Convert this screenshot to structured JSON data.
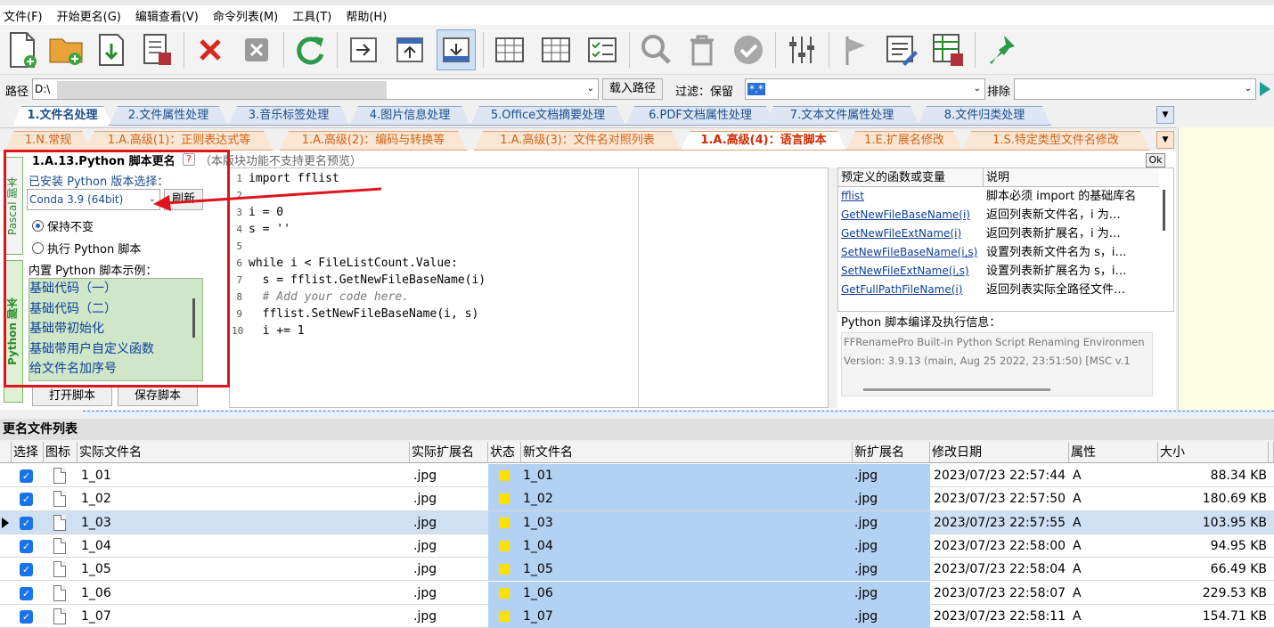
{
  "menu": [
    "文件(F)",
    "开始更名(G)",
    "编辑查看(V)",
    "命令列表(M)",
    "工具(T)",
    "帮助(H)"
  ],
  "icons": {
    "new": "new-file-icon",
    "open": "open-folder-icon",
    "import": "import-icon",
    "save": "save-icon",
    "delete": "delete-x-icon",
    "clear": "clear-x-icon",
    "refresh": "refresh-icon",
    "move": "move-icon",
    "up": "up-icon",
    "down": "down-icon",
    "grid1": "grid-view-icon",
    "grid2": "grid-view2-icon",
    "checklist": "checklist-icon",
    "search": "search-icon",
    "trash": "trash-icon",
    "check": "check-icon",
    "sliders": "sliders-icon",
    "flag": "flag-icon",
    "edit": "edit-doc-icon",
    "savegrid": "save-grid-icon",
    "pin": "pin-icon"
  },
  "pathbar": {
    "path_label": "路径",
    "path_value": "D:\\",
    "load_button": "载入路径",
    "filter_label": "过滤：保留",
    "filter_value": "*.*",
    "exclude_label": "排除"
  },
  "tabs_primary": [
    "1.文件名处理",
    "2.文件属性处理",
    "3.音乐标签处理",
    "4.图片信息处理",
    "5.Office文档摘要处理",
    "6.PDF文档属性处理",
    "7.文本文件属性处理",
    "8.文件归类处理"
  ],
  "tabs_secondary": [
    "1.N.常规",
    "1.A.高级(1)：正则表达式等",
    "1.A.高级(2)：编码与转换等",
    "1.A.高级(3)：文件名对照列表",
    "1.A.高级(4)：语言脚本",
    "1.E.扩展名修改",
    "1.S.特定类型文件名修改"
  ],
  "vertical_tabs": {
    "pascal": "Pascal 脚本",
    "python": "Python 脚本"
  },
  "script_panel": {
    "title": "1.A.13.Python 脚本更名",
    "help": "?",
    "note": "（本版块功能不支持更名预览）",
    "ok": "Ok",
    "installed_label": "已安装 Python 版本选择：",
    "version": "Conda 3.9 (64bit)",
    "refresh_button": "刷新",
    "keep_option": "保持不变",
    "run_option": "执行 Python 脚本",
    "examples_label": "内置 Python 脚本示例：",
    "examples": [
      "基础代码（一）",
      "基础代码（二）",
      "基础带初始化",
      "基础带用户自定义函数",
      "给文件名加序号"
    ],
    "open_button": "打开脚本",
    "save_button": "保存脚本"
  },
  "editor": {
    "lines": [
      {
        "n": "1",
        "code": "import fflist"
      },
      {
        "n": "2",
        "code": ""
      },
      {
        "n": "3",
        "code": "i = 0"
      },
      {
        "n": "4",
        "code": "s = ''"
      },
      {
        "n": "5",
        "code": ""
      },
      {
        "n": "6",
        "code": "while i < FileListCount.Value:"
      },
      {
        "n": "7",
        "code": "  s = fflist.GetNewFileBaseName(i)"
      },
      {
        "n": "8",
        "code": "  # Add your code here."
      },
      {
        "n": "9",
        "code": "  fflist.SetNewFileBaseName(i, s)"
      },
      {
        "n": "10",
        "code": "  i += 1"
      }
    ]
  },
  "functions": {
    "header_name": "预定义的函数或变量",
    "header_desc": "说明",
    "rows": [
      {
        "name": "fflist",
        "desc": "脚本必须 import 的基础库名"
      },
      {
        "name": "GetNewFileBaseName(i)",
        "desc": "返回列表新文件名，i 为…"
      },
      {
        "name": "GetNewFileExtName(i)",
        "desc": "返回列表新扩展名，i 为…"
      },
      {
        "name": "SetNewFileBaseName(i,s)",
        "desc": "设置列表新文件名为 s，i…"
      },
      {
        "name": "SetNewFileExtName(i,s)",
        "desc": "设置列表新扩展名为 s，i…"
      },
      {
        "name": "GetFullPathFileName(i)",
        "desc": "返回列表实际全路径文件…"
      }
    ]
  },
  "info": {
    "title": "Python 脚本编译及执行信息：",
    "line1": "FFRenamePro Built-in Python Script Renaming Environmen",
    "line2": "Version:  3.9.13 (main, Aug 25 2022, 23:51:50) [MSC v.1"
  },
  "list_title": "更名文件列表",
  "columns": [
    "选择",
    "图标",
    "实际文件名",
    "实际扩展名",
    "状态",
    "新文件名",
    "新扩展名",
    "修改日期",
    "属性",
    "大小"
  ],
  "files": [
    {
      "name": "1_01",
      "ext": ".jpg",
      "new": "1_01",
      "newext": ".jpg",
      "date": "2023/07/23 22:57:44",
      "attr": "A",
      "size": "88.34 KB"
    },
    {
      "name": "1_02",
      "ext": ".jpg",
      "new": "1_02",
      "newext": ".jpg",
      "date": "2023/07/23 22:57:50",
      "attr": "A",
      "size": "180.69 KB"
    },
    {
      "name": "1_03",
      "ext": ".jpg",
      "new": "1_03",
      "newext": ".jpg",
      "date": "2023/07/23 22:57:55",
      "attr": "A",
      "size": "103.95 KB"
    },
    {
      "name": "1_04",
      "ext": ".jpg",
      "new": "1_04",
      "newext": ".jpg",
      "date": "2023/07/23 22:58:00",
      "attr": "A",
      "size": "94.95 KB"
    },
    {
      "name": "1_05",
      "ext": ".jpg",
      "new": "1_05",
      "newext": ".jpg",
      "date": "2023/07/23 22:58:04",
      "attr": "A",
      "size": "66.49 KB"
    },
    {
      "name": "1_06",
      "ext": ".jpg",
      "new": "1_06",
      "newext": ".jpg",
      "date": "2023/07/23 22:58:07",
      "attr": "A",
      "size": "229.53 KB"
    },
    {
      "name": "1_07",
      "ext": ".jpg",
      "new": "1_07",
      "newext": ".jpg",
      "date": "2023/07/23 22:58:11",
      "attr": "A",
      "size": "154.71 KB"
    }
  ],
  "colors": {
    "accent": "#1b4d8f",
    "orange_tab": "#d06418",
    "highlight_red": "#e0141e",
    "selection": "#b3d1f2"
  }
}
